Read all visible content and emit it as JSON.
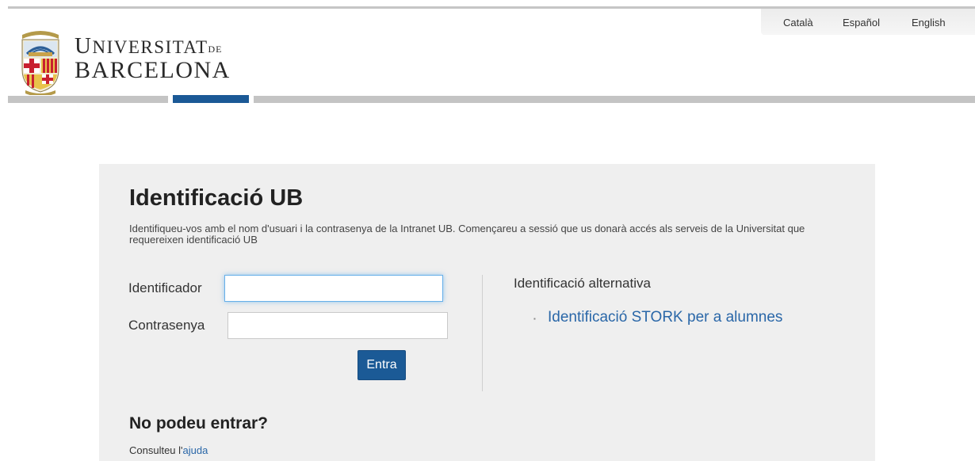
{
  "colors": {
    "brand_blue": "#1b5996",
    "link": "#2a67a8",
    "panel_bg": "#efefef",
    "band_gray": "#c4c4c4"
  },
  "header": {
    "languages": [
      "Català",
      "Español",
      "English"
    ],
    "logo": {
      "line1_prefix": "U",
      "line1_rest": "NIVERSITAT",
      "line1_suffix": "DE",
      "line2": "BARCELONA",
      "icon": "university-crest-icon"
    }
  },
  "login": {
    "title": "Identificació UB",
    "description": "Identifiqueu-vos amb el nom d'usuari i la contrasenya de la Intranet UB. Començareu a sessió que us donarà accés als serveis de la Universitat que requereixen identificació UB",
    "username_label": "Identificador",
    "username_value": "",
    "password_label": "Contrasenya",
    "password_value": "",
    "submit_label": "Entra"
  },
  "alternative": {
    "title": "Identificació alternativa",
    "bullet": "▪",
    "link": "Identificació STORK per a alumnes"
  },
  "help": {
    "title": "No podeu entrar?",
    "text_prefix": "Consulteu l'",
    "link": "ajuda"
  }
}
